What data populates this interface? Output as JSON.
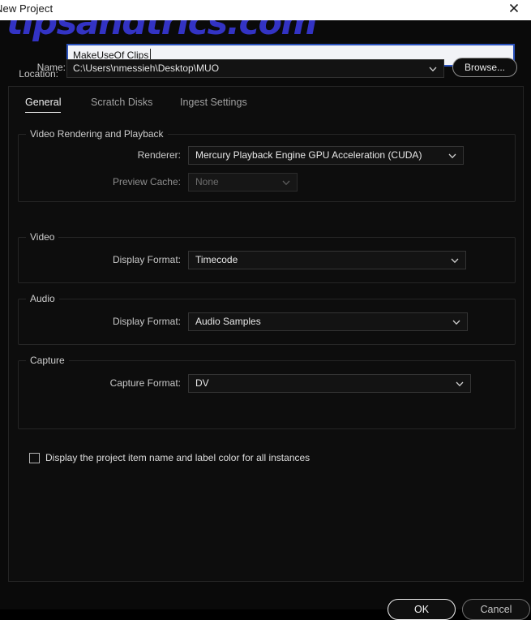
{
  "window": {
    "title": "New Project",
    "close_icon": "close-icon"
  },
  "watermark": {
    "text": "tipsandtrics.com",
    "color": "#3333c4"
  },
  "header": {
    "name_label": "Name:",
    "name_value": "MakeUseOf Clips",
    "location_label": "Location:",
    "location_value": "C:\\Users\\nmessieh\\Desktop\\MUO",
    "browse_label": "Browse..."
  },
  "tabs": [
    {
      "label": "General",
      "active": true
    },
    {
      "label": "Scratch Disks",
      "active": false
    },
    {
      "label": "Ingest Settings",
      "active": false
    }
  ],
  "groups": {
    "video_rendering": {
      "title": "Video Rendering and Playback",
      "renderer_label": "Renderer:",
      "renderer_value": "Mercury Playback Engine GPU Acceleration (CUDA)",
      "preview_cache_label": "Preview Cache:",
      "preview_cache_value": "None",
      "preview_cache_disabled": true
    },
    "video": {
      "title": "Video",
      "display_format_label": "Display Format:",
      "display_format_value": "Timecode"
    },
    "audio": {
      "title": "Audio",
      "display_format_label": "Display Format:",
      "display_format_value": "Audio Samples"
    },
    "capture": {
      "title": "Capture",
      "capture_format_label": "Capture Format:",
      "capture_format_value": "DV"
    }
  },
  "checkbox": {
    "label": "Display the project item name and label color for all instances",
    "checked": false
  },
  "footer": {
    "ok_label": "OK",
    "cancel_label": "Cancel"
  }
}
